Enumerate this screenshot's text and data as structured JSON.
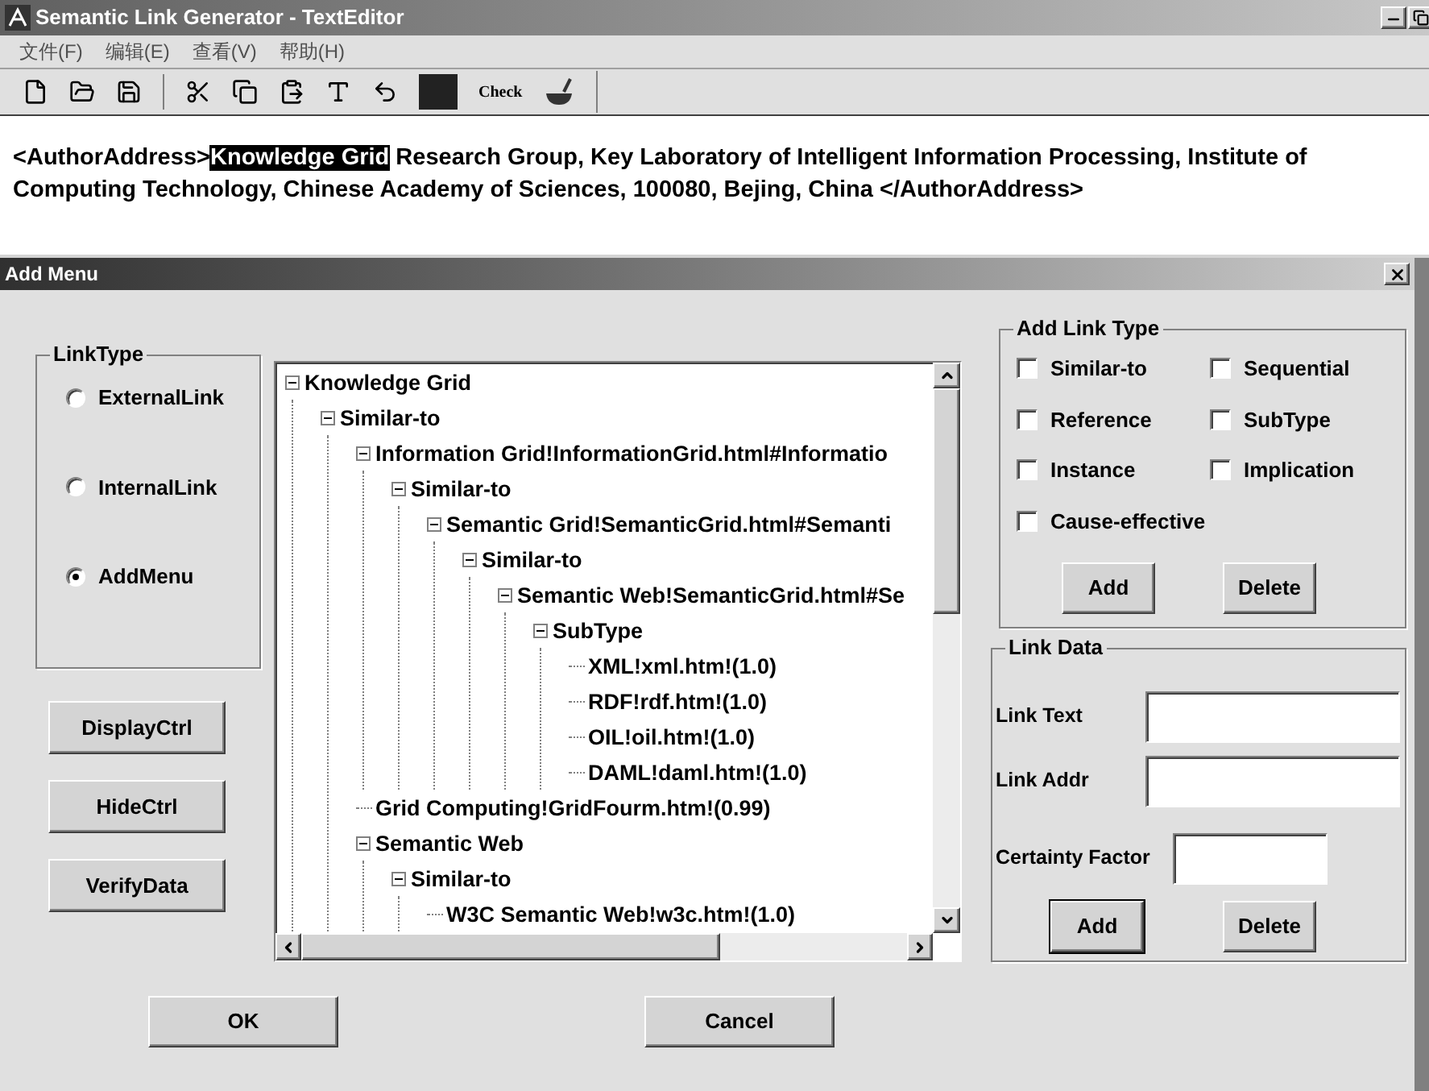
{
  "window": {
    "title": "Semantic Link Generator - TextEditor"
  },
  "menu": [
    "文件(F)",
    "编辑(E)",
    "查看(V)",
    "帮助(H)"
  ],
  "toolbar": {
    "check_label": "Check"
  },
  "editor": {
    "segments": [
      {
        "text": "<AuthorAddress>",
        "selected": false
      },
      {
        "text": "Knowledge Grid",
        "selected": true
      },
      {
        "text": " Research Group, Key Laboratory of Intelligent Information Processing, Institute of Computing Technology, Chinese Academy of Sciences, 100080, Bejing, China </AuthorAddress>",
        "selected": false
      }
    ]
  },
  "dialog": {
    "title": "Add Menu",
    "link_type": {
      "title": "LinkType",
      "options": [
        {
          "label": "ExternalLink",
          "selected": false
        },
        {
          "label": "InternalLink",
          "selected": false
        },
        {
          "label": "AddMenu",
          "selected": true
        }
      ]
    },
    "side_buttons": [
      "DisplayCtrl",
      "HideCtrl",
      "VerifyData"
    ],
    "tree": [
      {
        "label": "Knowledge Grid",
        "expanded": true,
        "children": [
          {
            "label": "Similar-to",
            "expanded": true,
            "children": [
              {
                "label": "Information Grid!InformationGrid.html#Informatio",
                "expanded": true,
                "children": [
                  {
                    "label": "Similar-to",
                    "expanded": true,
                    "children": [
                      {
                        "label": "Semantic Grid!SemanticGrid.html#Semanti",
                        "expanded": true,
                        "children": [
                          {
                            "label": "Similar-to",
                            "expanded": true,
                            "children": [
                              {
                                "label": "Semantic Web!SemanticGrid.html#Se",
                                "expanded": true,
                                "children": [
                                  {
                                    "label": "SubType",
                                    "expanded": true,
                                    "children": [
                                      {
                                        "label": "XML!xml.htm!(1.0)"
                                      },
                                      {
                                        "label": "RDF!rdf.htm!(1.0)"
                                      },
                                      {
                                        "label": "OIL!oil.htm!(1.0)"
                                      },
                                      {
                                        "label": "DAML!daml.htm!(1.0)"
                                      }
                                    ]
                                  }
                                ]
                              }
                            ]
                          }
                        ]
                      }
                    ]
                  }
                ]
              },
              {
                "label": "Grid Computing!GridFourm.htm!(0.99)"
              },
              {
                "label": "Semantic Web",
                "expanded": true,
                "children": [
                  {
                    "label": "Similar-to",
                    "expanded": true,
                    "children": [
                      {
                        "label": "W3C Semantic Web!w3c.htm!(1.0)"
                      }
                    ]
                  }
                ]
              }
            ]
          }
        ]
      }
    ],
    "add_link_type": {
      "title": "Add Link Type",
      "options": [
        {
          "label": "Similar-to",
          "checked": false
        },
        {
          "label": "Sequential",
          "checked": false
        },
        {
          "label": "Reference",
          "checked": false
        },
        {
          "label": "SubType",
          "checked": false
        },
        {
          "label": "Instance",
          "checked": false
        },
        {
          "label": "Implication",
          "checked": false
        },
        {
          "label": "Cause-effective",
          "checked": false
        }
      ],
      "buttons": [
        "Add",
        "Delete"
      ]
    },
    "link_data": {
      "title": "Link Data",
      "fields": [
        {
          "label": "Link Text"
        },
        {
          "label": "Link Addr"
        },
        {
          "label": "Certainty Factor"
        }
      ],
      "buttons": [
        "Add",
        "Delete"
      ]
    },
    "buttons": [
      "OK",
      "Cancel"
    ]
  }
}
